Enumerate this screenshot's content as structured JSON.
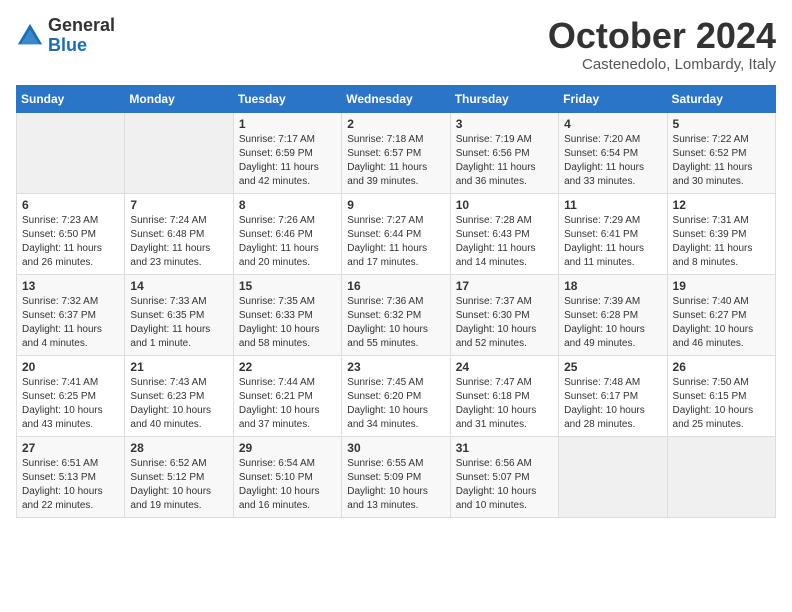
{
  "logo": {
    "general": "General",
    "blue": "Blue"
  },
  "title": {
    "month": "October 2024",
    "location": "Castenedolo, Lombardy, Italy"
  },
  "weekdays": [
    "Sunday",
    "Monday",
    "Tuesday",
    "Wednesday",
    "Thursday",
    "Friday",
    "Saturday"
  ],
  "weeks": [
    [
      {
        "day": "",
        "sunrise": "",
        "sunset": "",
        "daylight": ""
      },
      {
        "day": "",
        "sunrise": "",
        "sunset": "",
        "daylight": ""
      },
      {
        "day": "1",
        "sunrise": "Sunrise: 7:17 AM",
        "sunset": "Sunset: 6:59 PM",
        "daylight": "Daylight: 11 hours and 42 minutes."
      },
      {
        "day": "2",
        "sunrise": "Sunrise: 7:18 AM",
        "sunset": "Sunset: 6:57 PM",
        "daylight": "Daylight: 11 hours and 39 minutes."
      },
      {
        "day": "3",
        "sunrise": "Sunrise: 7:19 AM",
        "sunset": "Sunset: 6:56 PM",
        "daylight": "Daylight: 11 hours and 36 minutes."
      },
      {
        "day": "4",
        "sunrise": "Sunrise: 7:20 AM",
        "sunset": "Sunset: 6:54 PM",
        "daylight": "Daylight: 11 hours and 33 minutes."
      },
      {
        "day": "5",
        "sunrise": "Sunrise: 7:22 AM",
        "sunset": "Sunset: 6:52 PM",
        "daylight": "Daylight: 11 hours and 30 minutes."
      }
    ],
    [
      {
        "day": "6",
        "sunrise": "Sunrise: 7:23 AM",
        "sunset": "Sunset: 6:50 PM",
        "daylight": "Daylight: 11 hours and 26 minutes."
      },
      {
        "day": "7",
        "sunrise": "Sunrise: 7:24 AM",
        "sunset": "Sunset: 6:48 PM",
        "daylight": "Daylight: 11 hours and 23 minutes."
      },
      {
        "day": "8",
        "sunrise": "Sunrise: 7:26 AM",
        "sunset": "Sunset: 6:46 PM",
        "daylight": "Daylight: 11 hours and 20 minutes."
      },
      {
        "day": "9",
        "sunrise": "Sunrise: 7:27 AM",
        "sunset": "Sunset: 6:44 PM",
        "daylight": "Daylight: 11 hours and 17 minutes."
      },
      {
        "day": "10",
        "sunrise": "Sunrise: 7:28 AM",
        "sunset": "Sunset: 6:43 PM",
        "daylight": "Daylight: 11 hours and 14 minutes."
      },
      {
        "day": "11",
        "sunrise": "Sunrise: 7:29 AM",
        "sunset": "Sunset: 6:41 PM",
        "daylight": "Daylight: 11 hours and 11 minutes."
      },
      {
        "day": "12",
        "sunrise": "Sunrise: 7:31 AM",
        "sunset": "Sunset: 6:39 PM",
        "daylight": "Daylight: 11 hours and 8 minutes."
      }
    ],
    [
      {
        "day": "13",
        "sunrise": "Sunrise: 7:32 AM",
        "sunset": "Sunset: 6:37 PM",
        "daylight": "Daylight: 11 hours and 4 minutes."
      },
      {
        "day": "14",
        "sunrise": "Sunrise: 7:33 AM",
        "sunset": "Sunset: 6:35 PM",
        "daylight": "Daylight: 11 hours and 1 minute."
      },
      {
        "day": "15",
        "sunrise": "Sunrise: 7:35 AM",
        "sunset": "Sunset: 6:33 PM",
        "daylight": "Daylight: 10 hours and 58 minutes."
      },
      {
        "day": "16",
        "sunrise": "Sunrise: 7:36 AM",
        "sunset": "Sunset: 6:32 PM",
        "daylight": "Daylight: 10 hours and 55 minutes."
      },
      {
        "day": "17",
        "sunrise": "Sunrise: 7:37 AM",
        "sunset": "Sunset: 6:30 PM",
        "daylight": "Daylight: 10 hours and 52 minutes."
      },
      {
        "day": "18",
        "sunrise": "Sunrise: 7:39 AM",
        "sunset": "Sunset: 6:28 PM",
        "daylight": "Daylight: 10 hours and 49 minutes."
      },
      {
        "day": "19",
        "sunrise": "Sunrise: 7:40 AM",
        "sunset": "Sunset: 6:27 PM",
        "daylight": "Daylight: 10 hours and 46 minutes."
      }
    ],
    [
      {
        "day": "20",
        "sunrise": "Sunrise: 7:41 AM",
        "sunset": "Sunset: 6:25 PM",
        "daylight": "Daylight: 10 hours and 43 minutes."
      },
      {
        "day": "21",
        "sunrise": "Sunrise: 7:43 AM",
        "sunset": "Sunset: 6:23 PM",
        "daylight": "Daylight: 10 hours and 40 minutes."
      },
      {
        "day": "22",
        "sunrise": "Sunrise: 7:44 AM",
        "sunset": "Sunset: 6:21 PM",
        "daylight": "Daylight: 10 hours and 37 minutes."
      },
      {
        "day": "23",
        "sunrise": "Sunrise: 7:45 AM",
        "sunset": "Sunset: 6:20 PM",
        "daylight": "Daylight: 10 hours and 34 minutes."
      },
      {
        "day": "24",
        "sunrise": "Sunrise: 7:47 AM",
        "sunset": "Sunset: 6:18 PM",
        "daylight": "Daylight: 10 hours and 31 minutes."
      },
      {
        "day": "25",
        "sunrise": "Sunrise: 7:48 AM",
        "sunset": "Sunset: 6:17 PM",
        "daylight": "Daylight: 10 hours and 28 minutes."
      },
      {
        "day": "26",
        "sunrise": "Sunrise: 7:50 AM",
        "sunset": "Sunset: 6:15 PM",
        "daylight": "Daylight: 10 hours and 25 minutes."
      }
    ],
    [
      {
        "day": "27",
        "sunrise": "Sunrise: 6:51 AM",
        "sunset": "Sunset: 5:13 PM",
        "daylight": "Daylight: 10 hours and 22 minutes."
      },
      {
        "day": "28",
        "sunrise": "Sunrise: 6:52 AM",
        "sunset": "Sunset: 5:12 PM",
        "daylight": "Daylight: 10 hours and 19 minutes."
      },
      {
        "day": "29",
        "sunrise": "Sunrise: 6:54 AM",
        "sunset": "Sunset: 5:10 PM",
        "daylight": "Daylight: 10 hours and 16 minutes."
      },
      {
        "day": "30",
        "sunrise": "Sunrise: 6:55 AM",
        "sunset": "Sunset: 5:09 PM",
        "daylight": "Daylight: 10 hours and 13 minutes."
      },
      {
        "day": "31",
        "sunrise": "Sunrise: 6:56 AM",
        "sunset": "Sunset: 5:07 PM",
        "daylight": "Daylight: 10 hours and 10 minutes."
      },
      {
        "day": "",
        "sunrise": "",
        "sunset": "",
        "daylight": ""
      },
      {
        "day": "",
        "sunrise": "",
        "sunset": "",
        "daylight": ""
      }
    ]
  ]
}
